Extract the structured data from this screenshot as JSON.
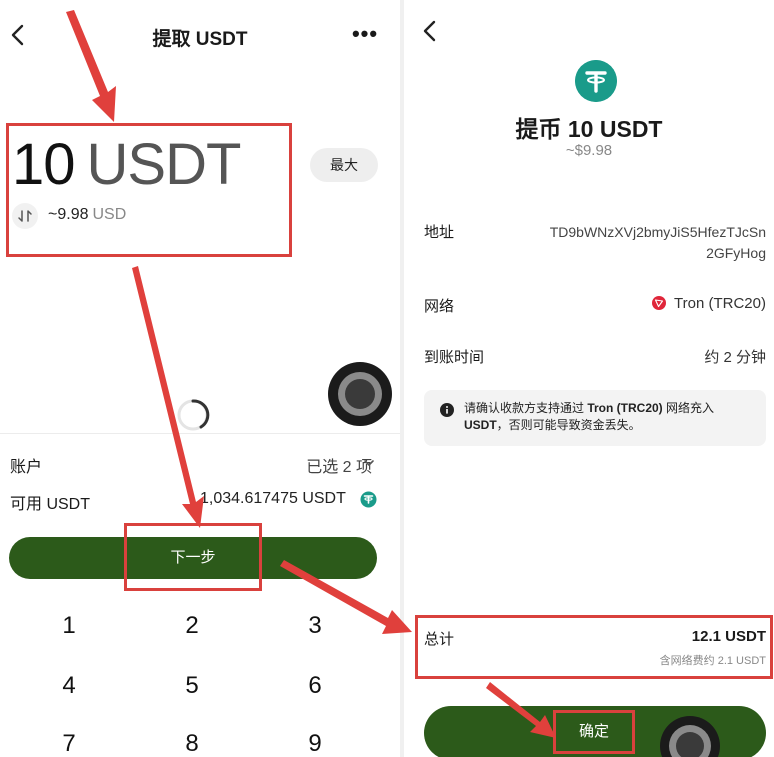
{
  "left": {
    "title": "提取 USDT",
    "more_label": "•••",
    "amount_number": "10",
    "amount_unit": "USDT",
    "approx_value": "~9.98",
    "approx_currency": "USD",
    "max_label": "最大",
    "account_label": "账户",
    "account_value": "已选 2 项",
    "available_label": "可用 USDT",
    "available_value": "1,034.617475 USDT",
    "next_label": "下一步",
    "keypad": [
      "1",
      "2",
      "3",
      "4",
      "5",
      "6",
      "7",
      "8",
      "9"
    ]
  },
  "right": {
    "title": "提币 10 USDT",
    "subtitle": "~$9.98",
    "address_label": "地址",
    "address_line1": "TD9bWNzXVj2bmyJiS5HfezTJcSn",
    "address_line2": "2GFyHog",
    "network_label": "网络",
    "network_value": "Tron (TRC20)",
    "time_label": "到账时间",
    "time_value": "约 2 分钟",
    "notice_prefix": "请确认收款方支持通过 ",
    "notice_bold_network": "Tron (TRC20)",
    "notice_middle": " 网络充入 ",
    "notice_bold_token": "USDT",
    "notice_suffix": "，否则可能导致资金丢失。",
    "total_label": "总计",
    "total_value": "12.1 USDT",
    "fee_value": "含网络费约 2.1 USDT",
    "confirm_label": "确定"
  },
  "colors": {
    "primary_green": "#2c5a1a",
    "annotation_red": "#d9413d",
    "usdt_teal": "#1a9b8a",
    "tron_red": "#e0263a"
  }
}
